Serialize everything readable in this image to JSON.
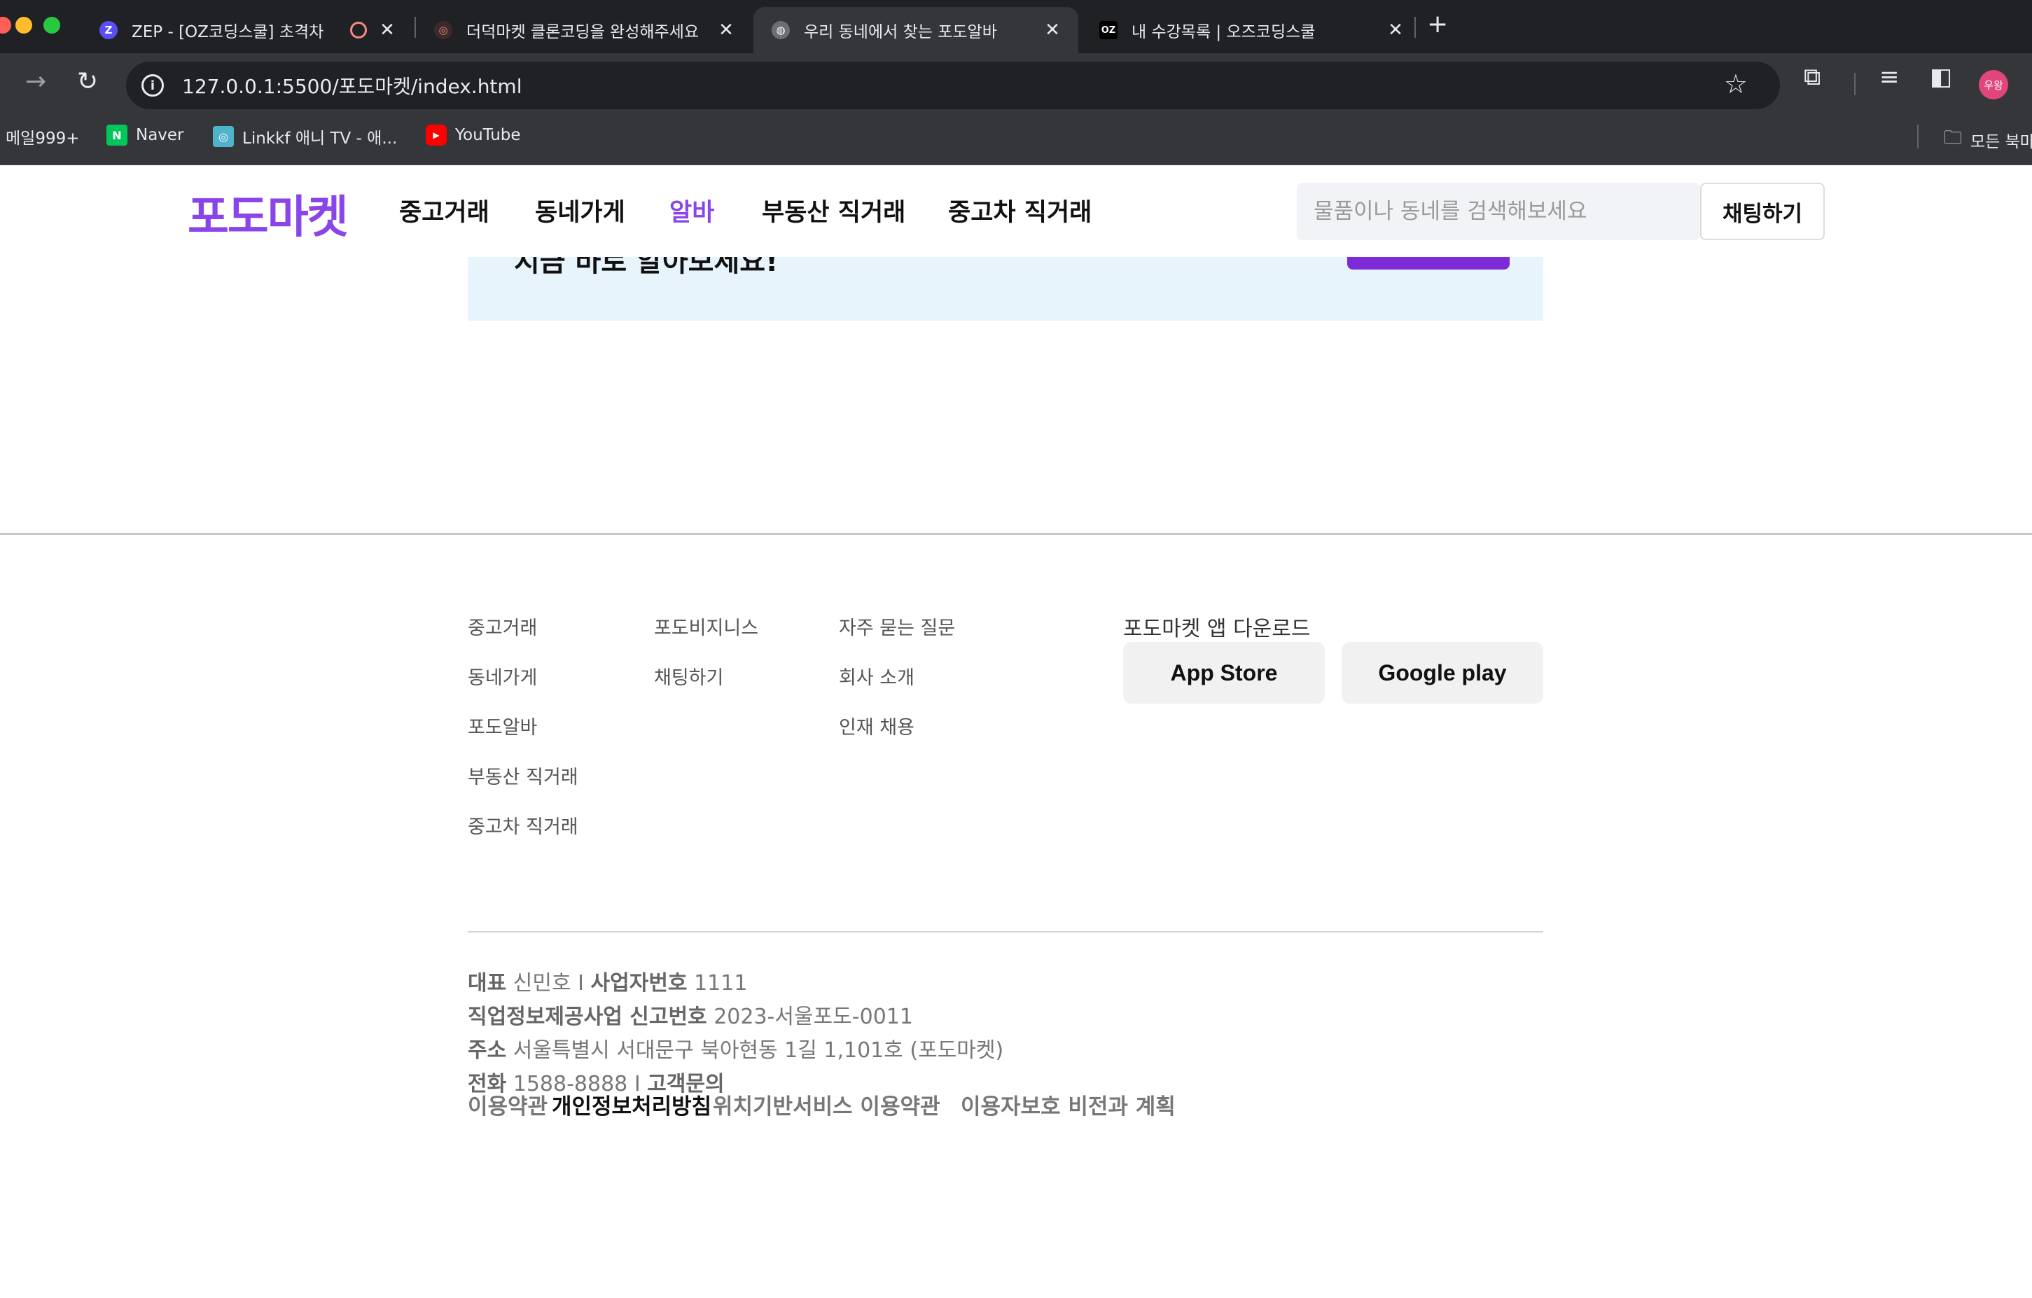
{
  "browser": {
    "tabs": [
      {
        "title": "ZEP - [OZ코딩스쿨] 초격차",
        "favicon": "zep-icon"
      },
      {
        "title": "더덕마켓 클론코딩을 완성해주세요",
        "favicon": "target-icon"
      },
      {
        "title": "우리 동네에서 찾는 포도알바",
        "favicon": "globe-icon",
        "active": true
      },
      {
        "title": "내 수강목록 | 오즈코딩스쿨",
        "favicon": "oz-icon"
      }
    ],
    "url": "127.0.0.1:5500/포도마켓/index.html",
    "profile_initials": "우왕",
    "bookmarks": [
      {
        "label": "메일999+"
      },
      {
        "label": "Naver"
      },
      {
        "label": "Linkkf 애니 TV - 애..."
      },
      {
        "label": "YouTube"
      }
    ],
    "all_bookmarks_label": "모든 북마"
  },
  "header": {
    "logo": "포도마켓",
    "nav": [
      "중고거래",
      "동네가게",
      "알바",
      "부동산 직거래",
      "중고차 직거래"
    ],
    "active_nav": "알바",
    "search_placeholder": "물품이나 동네를 검색해보세요",
    "chat_button": "채팅하기"
  },
  "banner": {
    "text": "지금 바로 알아보세요!"
  },
  "footer": {
    "columns": [
      [
        "중고거래",
        "동네가게",
        "포도알바",
        "부동산 직거래",
        "중고차 직거래"
      ],
      [
        "포도비지니스",
        "채팅하기"
      ],
      [
        "자주 묻는 질문",
        "회사 소개",
        "인재 채용"
      ]
    ],
    "app_download_title": "포도마켓 앱 다운로드",
    "app_buttons": [
      "App Store",
      "Google play"
    ],
    "company_info": {
      "ceo_label": "대표",
      "ceo_value": "신민호",
      "sep": "I",
      "biz_label": "사업자번호",
      "biz_value": "1111",
      "report_label": "직업정보제공사업 신고번호",
      "report_value": "2023-서울포도-0011",
      "address_label": "주소",
      "address_value": "서울특별시 서대문구 북아현동 1길 1,101호 (포도마켓)",
      "phone_label": "전화",
      "phone_value": "1588-8888",
      "inquiry_label": "고객문의"
    },
    "policies": [
      "이용약관",
      "개인정보처리방침",
      "위치기반서비스 이용약관",
      "이용자보호 비전과 계획"
    ]
  },
  "colors": {
    "brand": "#8a45e8",
    "banner_bg": "#e8f4fc",
    "banner_button": "#7d2bd6"
  }
}
